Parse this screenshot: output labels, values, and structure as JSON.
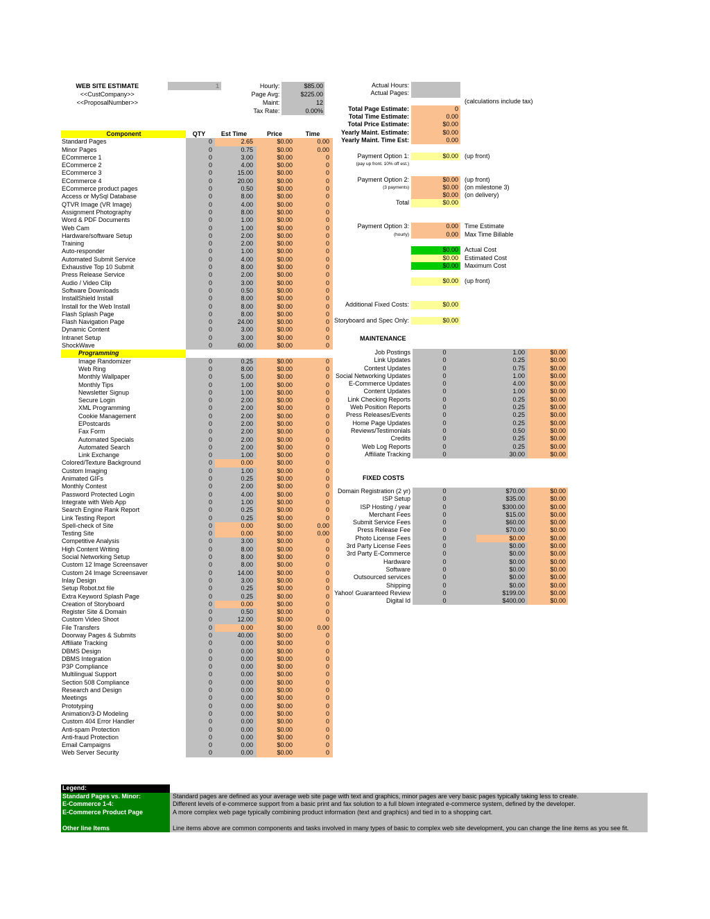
{
  "header": {
    "title": "WEB SITE ESTIMATE",
    "cust_company": "<<CustCompany>>",
    "proposal_number": "<<ProposalNumber>>",
    "sheet_number": "1",
    "rates": [
      {
        "label": "Hourly:",
        "value": "$85.00"
      },
      {
        "label": "Page Avg:",
        "value": "$225.00"
      },
      {
        "label": "Maint:",
        "value": "12"
      },
      {
        "label": "Tax Rate:",
        "value": "0.00%"
      }
    ]
  },
  "summary": {
    "actuals": [
      {
        "label": "Actual Hours:",
        "value": ""
      },
      {
        "label": "Actual Pages:",
        "value": ""
      }
    ],
    "tax_note": "(calculations include tax)",
    "totals": [
      {
        "label": "Total Page Estimate:",
        "value": "0"
      },
      {
        "label": "Total Time Estimate:",
        "value": "0.00"
      },
      {
        "label": "Total Price Estimate:",
        "value": "$0.00"
      },
      {
        "label": "Yearly Maint. Estimate:",
        "value": "$0.00"
      },
      {
        "label": "Yearly Maint. Time Est:",
        "value": "0.00"
      }
    ],
    "option1": {
      "label": "Payment Option 1:",
      "sub": "(pay up front. 10% off est.)",
      "value": "$0.00",
      "note": "(up front)"
    },
    "option2": {
      "label": "Payment Option 2:",
      "sub": "(3 payments)",
      "rows": [
        {
          "value": "$0.00",
          "note": "(up front)"
        },
        {
          "value": "$0.00",
          "note": "(on milestone 3)"
        },
        {
          "value": "$0.00",
          "note": "(on delivery)"
        }
      ],
      "total_label": "Total",
      "total_value": "$0.00"
    },
    "option3": {
      "label": "Payment Option 3:",
      "sub": "(hourly)",
      "rows": [
        {
          "value": "0.00",
          "note": "Time Estimate"
        },
        {
          "value": "0.00",
          "note": "Max Time Billable"
        }
      ]
    },
    "costs": [
      {
        "value": "$0.00",
        "note": "Actual Cost"
      },
      {
        "value": "$0.00",
        "note": "Estimated Cost"
      },
      {
        "value": "$0.00",
        "note": "Maximum Cost"
      }
    ],
    "upfront": {
      "value": "$0.00",
      "note": "(up front)"
    },
    "additional_fixed": {
      "label": "Additional Fixed Costs:",
      "value": "$0.00"
    },
    "storyboard": {
      "label": "Storyboard and Spec Only:",
      "value": "$0.00"
    }
  },
  "component_table": {
    "headers": [
      "Component",
      "QTY",
      "Est Time",
      "Price",
      "Time"
    ],
    "rows": [
      {
        "name": "Standard Pages",
        "qty": "0",
        "est": "2.65",
        "price": "$0.00",
        "time": "0.00",
        "est_hl": true
      },
      {
        "name": "Minor Pages",
        "qty": "0",
        "est": "0.75",
        "price": "$0.00",
        "time": "0.00"
      },
      {
        "name": "ECommerce 1",
        "qty": "0",
        "est": "3.00",
        "price": "$0.00",
        "time": "0"
      },
      {
        "name": "ECommerce 2",
        "qty": "0",
        "est": "4.00",
        "price": "$0.00",
        "time": "0"
      },
      {
        "name": "ECommerce 3",
        "qty": "0",
        "est": "15.00",
        "price": "$0.00",
        "time": "0"
      },
      {
        "name": "ECommerce 4",
        "qty": "0",
        "est": "20.00",
        "price": "$0.00",
        "time": "0"
      },
      {
        "name": "ECommerce product pages",
        "qty": "0",
        "est": "0.50",
        "price": "$0.00",
        "time": "0"
      },
      {
        "name": "Access or MySql Database",
        "qty": "0",
        "est": "8.00",
        "price": "$0.00",
        "time": "0"
      },
      {
        "name": "QTVR Image (VR Image)",
        "qty": "0",
        "est": "4.00",
        "price": "$0.00",
        "time": "0"
      },
      {
        "name": "Assignment Photography",
        "qty": "0",
        "est": "8.00",
        "price": "$0.00",
        "time": "0"
      },
      {
        "name": "Word & PDF Documents",
        "qty": "0",
        "est": "1.00",
        "price": "$0.00",
        "time": "0"
      },
      {
        "name": "Web Cam",
        "qty": "0",
        "est": "1.00",
        "price": "$0.00",
        "time": "0"
      },
      {
        "name": "Hardware/software Setup",
        "qty": "0",
        "est": "2.00",
        "price": "$0.00",
        "time": "0"
      },
      {
        "name": "Training",
        "qty": "0",
        "est": "2.00",
        "price": "$0.00",
        "time": "0"
      },
      {
        "name": "Auto-responder",
        "qty": "0",
        "est": "1.00",
        "price": "$0.00",
        "time": "0"
      },
      {
        "name": "Automated Submit Service",
        "qty": "0",
        "est": "4.00",
        "price": "$0.00",
        "time": "0"
      },
      {
        "name": "Exhaustive Top 10 Submit",
        "qty": "0",
        "est": "8.00",
        "price": "$0.00",
        "time": "0"
      },
      {
        "name": "Press Release Service",
        "qty": "0",
        "est": "2.00",
        "price": "$0.00",
        "time": "0"
      },
      {
        "name": "Audio / Video Clip",
        "qty": "0",
        "est": "3.00",
        "price": "$0.00",
        "time": "0"
      },
      {
        "name": "Software Downloads",
        "qty": "0",
        "est": "0.50",
        "price": "$0.00",
        "time": "0"
      },
      {
        "name": "InstallShield Install",
        "qty": "0",
        "est": "8.00",
        "price": "$0.00",
        "time": "0"
      },
      {
        "name": "Install for the Web Install",
        "qty": "0",
        "est": "8.00",
        "price": "$0.00",
        "time": "0"
      },
      {
        "name": "Flash Splash Page",
        "qty": "0",
        "est": "8.00",
        "price": "$0.00",
        "time": "0"
      },
      {
        "name": "Flash Navigation Page",
        "qty": "0",
        "est": "24.00",
        "price": "$0.00",
        "time": "0"
      },
      {
        "name": "Dynamic Content",
        "qty": "0",
        "est": "3.00",
        "price": "$0.00",
        "time": "0"
      },
      {
        "name": "Intranet Setup",
        "qty": "0",
        "est": "3.00",
        "price": "$0.00",
        "time": "0"
      },
      {
        "name": "ShockWave",
        "qty": "0",
        "est": "60.00",
        "price": "$0.00",
        "time": "0"
      },
      {
        "name": "Programming",
        "section": true
      },
      {
        "name": "Image Randomizer",
        "qty": "0",
        "est": "0.25",
        "price": "$0.00",
        "time": "0",
        "indent": true
      },
      {
        "name": "Web Ring",
        "qty": "0",
        "est": "8.00",
        "price": "$0.00",
        "time": "0",
        "indent": true
      },
      {
        "name": "Monthly Wallpaper",
        "qty": "0",
        "est": "5.00",
        "price": "$0.00",
        "time": "0",
        "indent": true
      },
      {
        "name": "Monthly Tips",
        "qty": "0",
        "est": "1.00",
        "price": "$0.00",
        "time": "0",
        "indent": true
      },
      {
        "name": "Newsletter Signup",
        "qty": "0",
        "est": "1.00",
        "price": "$0.00",
        "time": "0",
        "indent": true
      },
      {
        "name": "Secure Login",
        "qty": "0",
        "est": "2.00",
        "price": "$0.00",
        "time": "0",
        "indent": true
      },
      {
        "name": "XML Programming",
        "qty": "0",
        "est": "2.00",
        "price": "$0.00",
        "time": "0",
        "indent": true
      },
      {
        "name": "Cookie Management",
        "qty": "0",
        "est": "2.00",
        "price": "$0.00",
        "time": "0",
        "indent": true
      },
      {
        "name": "EPostcards",
        "qty": "0",
        "est": "2.00",
        "price": "$0.00",
        "time": "0",
        "indent": true
      },
      {
        "name": "Fax Form",
        "qty": "0",
        "est": "2.00",
        "price": "$0.00",
        "time": "0",
        "indent": true
      },
      {
        "name": "Automated Specials",
        "qty": "0",
        "est": "2.00",
        "price": "$0.00",
        "time": "0",
        "indent": true
      },
      {
        "name": "Automated Search",
        "qty": "0",
        "est": "2.00",
        "price": "$0.00",
        "time": "0",
        "indent": true
      },
      {
        "name": "Link Exchange",
        "qty": "0",
        "est": "1.00",
        "price": "$0.00",
        "time": "0",
        "indent": true
      },
      {
        "name": "Colored/Texture Background",
        "qty": "0",
        "est": "0.00",
        "price": "$0.00",
        "time": "0",
        "est_hl": true
      },
      {
        "name": "Custom Imaging",
        "qty": "0",
        "est": "1.00",
        "price": "$0.00",
        "time": "0"
      },
      {
        "name": "Animated GIFs",
        "qty": "0",
        "est": "0.25",
        "price": "$0.00",
        "time": "0"
      },
      {
        "name": "Monthly Contest",
        "qty": "0",
        "est": "2.00",
        "price": "$0.00",
        "time": "0"
      },
      {
        "name": "Password Protected Login",
        "qty": "0",
        "est": "4.00",
        "price": "$0.00",
        "time": "0"
      },
      {
        "name": "Integrate with Web App",
        "qty": "0",
        "est": "1.00",
        "price": "$0.00",
        "time": "0"
      },
      {
        "name": "Search Engine Rank Report",
        "qty": "0",
        "est": "0.25",
        "price": "$0.00",
        "time": "0"
      },
      {
        "name": "Link Testing Report",
        "qty": "0",
        "est": "0.25",
        "price": "$0.00",
        "time": "0"
      },
      {
        "name": "Spell-check of Site",
        "qty": "0",
        "est": "0.00",
        "price": "$0.00",
        "time": "0.00",
        "est_hl": true
      },
      {
        "name": "Testing Site",
        "qty": "0",
        "est": "0.00",
        "price": "$0.00",
        "time": "0.00",
        "est_hl": true
      },
      {
        "name": "Competitive Analysis",
        "qty": "0",
        "est": "3.00",
        "price": "$0.00",
        "time": "0"
      },
      {
        "name": "High Content Writing",
        "qty": "0",
        "est": "8.00",
        "price": "$0.00",
        "time": "0"
      },
      {
        "name": "Social Networking Setup",
        "qty": "0",
        "est": "8.00",
        "price": "$0.00",
        "time": "0"
      },
      {
        "name": "Custom 12 Image Screensaver",
        "qty": "0",
        "est": "8.00",
        "price": "$0.00",
        "time": "0"
      },
      {
        "name": "Custom 24 Image Screensaver",
        "qty": "0",
        "est": "14.00",
        "price": "$0.00",
        "time": "0"
      },
      {
        "name": "Inlay Design",
        "qty": "0",
        "est": "3.00",
        "price": "$0.00",
        "time": "0"
      },
      {
        "name": "Setup Robot.txt file",
        "qty": "0",
        "est": "0.25",
        "price": "$0.00",
        "time": "0"
      },
      {
        "name": "Extra Keyword Splash Page",
        "qty": "0",
        "est": "0.25",
        "price": "$0.00",
        "time": "0"
      },
      {
        "name": "Creation of Storyboard",
        "qty": "0",
        "est": "0.00",
        "price": "$0.00",
        "time": "0",
        "est_hl": true
      },
      {
        "name": "Register Site & Domain",
        "qty": "0",
        "est": "0.50",
        "price": "$0.00",
        "time": "0"
      },
      {
        "name": "Custom Video Shoot",
        "qty": "0",
        "est": "12.00",
        "price": "$0.00",
        "time": "0"
      },
      {
        "name": "File Transfers",
        "qty": "0",
        "est": "0.00",
        "price": "$0.00",
        "time": "0.00",
        "est_hl": true
      },
      {
        "name": "Doorway Pages & Submits",
        "qty": "0",
        "est": "40.00",
        "price": "$0.00",
        "time": "0"
      },
      {
        "name": "Affiliate Tracking",
        "qty": "0",
        "est": "0.00",
        "price": "$0.00",
        "time": "0"
      },
      {
        "name": "DBMS Design",
        "qty": "0",
        "est": "0.00",
        "price": "$0.00",
        "time": "0"
      },
      {
        "name": "DBMS Integration",
        "qty": "0",
        "est": "0.00",
        "price": "$0.00",
        "time": "0"
      },
      {
        "name": "P3P Compliance",
        "qty": "0",
        "est": "0.00",
        "price": "$0.00",
        "time": "0"
      },
      {
        "name": "Multilingual Support",
        "qty": "0",
        "est": "0.00",
        "price": "$0.00",
        "time": "0"
      },
      {
        "name": "Section 508 Compliance",
        "qty": "0",
        "est": "0.00",
        "price": "$0.00",
        "time": "0"
      },
      {
        "name": "Research and Design",
        "qty": "0",
        "est": "0.00",
        "price": "$0.00",
        "time": "0"
      },
      {
        "name": "Meetings",
        "qty": "0",
        "est": "0.00",
        "price": "$0.00",
        "time": "0"
      },
      {
        "name": "Prototyping",
        "qty": "0",
        "est": "0.00",
        "price": "$0.00",
        "time": "0"
      },
      {
        "name": "Animation/3-D Modeling",
        "qty": "0",
        "est": "0.00",
        "price": "$0.00",
        "time": "0"
      },
      {
        "name": "Custom 404 Error Handler",
        "qty": "0",
        "est": "0.00",
        "price": "$0.00",
        "time": "0"
      },
      {
        "name": "Anti-spam Protection",
        "qty": "0",
        "est": "0.00",
        "price": "$0.00",
        "time": "0"
      },
      {
        "name": "Anti-fraud Protection",
        "qty": "0",
        "est": "0.00",
        "price": "$0.00",
        "time": "0"
      },
      {
        "name": "Email Campaigns",
        "qty": "0",
        "est": "0.00",
        "price": "$0.00",
        "time": "0"
      },
      {
        "name": "Web Server Security",
        "qty": "0",
        "est": "0.00",
        "price": "$0.00",
        "time": "0"
      }
    ]
  },
  "maintenance": {
    "title": "MAINTENANCE",
    "rows": [
      {
        "name": "Job Postings",
        "qty": "0",
        "rate": "1.00",
        "total": "$0.00"
      },
      {
        "name": "Link Updates",
        "qty": "0",
        "rate": "0.25",
        "total": "$0.00"
      },
      {
        "name": "Contest Updates",
        "qty": "0",
        "rate": "0.75",
        "total": "$0.00"
      },
      {
        "name": "Social Networking Updates",
        "qty": "0",
        "rate": "1.00",
        "total": "$0.00"
      },
      {
        "name": "E-Commerce Updates",
        "qty": "0",
        "rate": "4.00",
        "total": "$0.00"
      },
      {
        "name": "Content Updates",
        "qty": "0",
        "rate": "1.00",
        "total": "$0.00"
      },
      {
        "name": "Link Checking Reports",
        "qty": "0",
        "rate": "0.25",
        "total": "$0.00"
      },
      {
        "name": "Web Position Reports",
        "qty": "0",
        "rate": "0.25",
        "total": "$0.00"
      },
      {
        "name": "Press Releases/Events",
        "qty": "0",
        "rate": "0.25",
        "total": "$0.00"
      },
      {
        "name": "Home Page Updates",
        "qty": "0",
        "rate": "0.25",
        "total": "$0.00"
      },
      {
        "name": "Reviews/Testimonials",
        "qty": "0",
        "rate": "0.50",
        "total": "$0.00"
      },
      {
        "name": "Credits",
        "qty": "0",
        "rate": "0.25",
        "total": "$0.00"
      },
      {
        "name": "Web Log Reports",
        "qty": "0",
        "rate": "0.25",
        "total": "$0.00"
      },
      {
        "name": "Affiliate Tracking",
        "qty": "0",
        "rate": "30.00",
        "total": "$0.00"
      }
    ]
  },
  "fixed_costs": {
    "title": "FIXED COSTS",
    "rows": [
      {
        "name": "Domain Registration (2 yr)",
        "qty": "0",
        "rate": "$70.00",
        "total": "$0.00"
      },
      {
        "name": "ISP Setup",
        "qty": "0",
        "rate": "$35.00",
        "total": "$0.00"
      },
      {
        "name": "ISP Hosting / year",
        "qty": "0",
        "rate": "$300.00",
        "total": "$0.00"
      },
      {
        "name": "Merchant Fees",
        "qty": "0",
        "rate": "$15.00",
        "total": "$0.00"
      },
      {
        "name": "Submit Service Fees",
        "qty": "0",
        "rate": "$60.00",
        "total": "$0.00"
      },
      {
        "name": "Press Release Fee",
        "qty": "0",
        "rate": "$70.00",
        "total": "$0.00"
      },
      {
        "name": "Photo License Fees",
        "qty": "0",
        "rate": "$0.00",
        "total": "$0.00",
        "rate_hl": true
      },
      {
        "name": "3rd Party License Fees",
        "qty": "0",
        "rate": "$0.00",
        "total": "$0.00"
      },
      {
        "name": "3rd Party E-Commerce",
        "qty": "0",
        "rate": "$0.00",
        "total": "$0.00"
      },
      {
        "name": "Hardware",
        "qty": "0",
        "rate": "$0.00",
        "total": "$0.00"
      },
      {
        "name": "Software",
        "qty": "0",
        "rate": "$0.00",
        "total": "$0.00"
      },
      {
        "name": "Outsourced services",
        "qty": "0",
        "rate": "$0.00",
        "total": "$0.00"
      },
      {
        "name": "Shipping",
        "qty": "0",
        "rate": "$0.00",
        "total": "$0.00"
      },
      {
        "name": "Yahoo! Guaranteed Review",
        "qty": "0",
        "rate": "$199.00",
        "total": "$0.00"
      },
      {
        "name": "Digital Id",
        "qty": "0",
        "rate": "$400.00",
        "total": "$0.00"
      }
    ]
  },
  "legend": {
    "title": "Legend:",
    "entries": [
      {
        "key": "Standard Pages vs. Minor:",
        "text": "Standard pages are defined as your average web site page with text and graphics, minor pages are very basic pages typically taking less to create."
      },
      {
        "key": "E-Commerce 1-4:",
        "text": "Different levels of e-commerce support from a basic print and fax solution to a full blown integrated e-commerce system, defined by the developer."
      },
      {
        "key": "E-Commerce Product Page",
        "text": "A more complex web page typically combining product information (text and graphics) and tied in to a shopping cart."
      },
      {
        "key": "",
        "text": ""
      },
      {
        "key": "Other line Items",
        "text": "Line items above are common components and tasks involved in many types of basic to complex web site development, you can change the line items as you see fit."
      }
    ]
  },
  "colors": {
    "gray": "#c0c0c0",
    "orange": "#fac090",
    "yellow": "#ffff00",
    "light_yellow": "#ffff99",
    "green": "#00cc00",
    "dark_green": "#008000",
    "black": "#000000"
  }
}
